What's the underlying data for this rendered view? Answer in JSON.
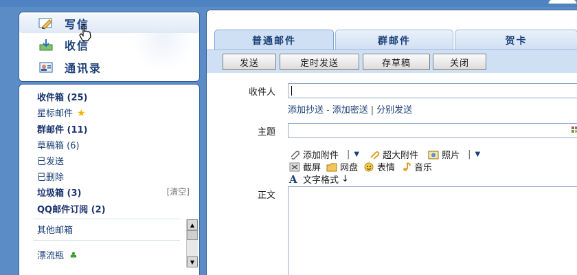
{
  "left": {
    "actions": [
      {
        "label": "写信",
        "icon": "pencil-icon"
      },
      {
        "label": "收信",
        "icon": "inbox-download-icon"
      },
      {
        "label": "通讯录",
        "icon": "address-book-icon"
      }
    ],
    "folders": [
      {
        "label": "收件箱 (25)",
        "bold": true
      },
      {
        "label": "星标邮件",
        "bold": false,
        "icon": "star-icon"
      },
      {
        "label": "群邮件 (11)",
        "bold": true
      },
      {
        "label": "草稿箱 (6)",
        "bold": false
      },
      {
        "label": "已发送",
        "bold": false
      },
      {
        "label": "已删除",
        "bold": false
      },
      {
        "label": "垃圾箱 (3)",
        "bold": true
      },
      {
        "label": "QQ邮件订阅 (2)",
        "bold": true
      }
    ],
    "clear_label": "[清空]",
    "other_mailboxes": "其他邮箱",
    "drift_bottle": "漂流瓶"
  },
  "compose": {
    "tabs": [
      {
        "label": "普通邮件",
        "active": true
      },
      {
        "label": "群邮件",
        "active": false
      },
      {
        "label": "贺卡",
        "active": false
      }
    ],
    "toolbar": {
      "send": "发送",
      "scheduled_send": "定时发送",
      "save_draft": "存草稿",
      "close": "关闭"
    },
    "recipient_label": "收件人",
    "recipient_value": "",
    "links": {
      "add_cc": "添加抄送",
      "dash": "-",
      "add_bcc": "添加密送",
      "pipe": "|",
      "separate_send": "分别发送"
    },
    "subject_label": "主题",
    "subject_value": "",
    "attach": {
      "add_attachment": "添加附件",
      "large_attachment": "超大附件",
      "photo": "照片",
      "screenshot": "截屏",
      "netdisk": "网盘",
      "emoticon": "表情",
      "music": "音乐",
      "text_format": "文字格式",
      "arrow": "↓"
    },
    "body_label": "正文",
    "body_value": ""
  }
}
